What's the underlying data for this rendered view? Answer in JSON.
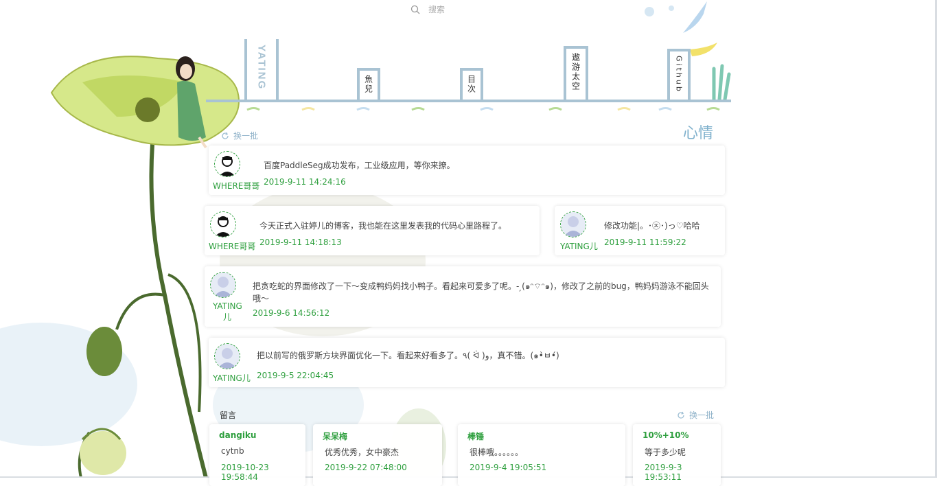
{
  "search": {
    "placeholder": "搜索"
  },
  "nav": {
    "brand": "YATING",
    "tabs": [
      {
        "label": "魚兒"
      },
      {
        "label": "目次"
      },
      {
        "label": "遨游太空"
      },
      {
        "label": "Github"
      }
    ]
  },
  "mood": {
    "refresh_label": "换一批",
    "title": "心情",
    "posts": [
      {
        "author": "WHERE哥哥",
        "content": "百度PaddleSeg成功发布，工业级应用，等你来撩。",
        "time": "2019-9-11 14:24:16"
      },
      {
        "author": "WHERE哥哥",
        "content": "今天正式入驻婷儿的博客，我也能在这里发表我的代码心里路程了。",
        "time": "2019-9-11 14:18:13"
      },
      {
        "author": "YATING儿",
        "content": "修改功能|。･㉨･)っ♡哈哈",
        "time": "2019-9-11 11:59:22"
      },
      {
        "author": "YATING儿",
        "content": "把贪吃蛇的界面修改了一下～变成鸭妈妈找小鸭子。看起来可爱多了呢。- ̗(๑ᵔ⌔ᵔ๑)，修改了之前的bug，鸭妈妈游泳不能回头哦～",
        "time": "2019-9-6 14:56:12"
      },
      {
        "author": "YATING儿",
        "content": "把以前写的俄罗斯方块界面优化一下。看起来好看多了。٩( ᐛ )و，真不错。(๑•̀ㅂ•́)",
        "time": "2019-9-5 22:04:45"
      }
    ]
  },
  "messages": {
    "label": "留言",
    "refresh_label": "换一批",
    "items": [
      {
        "name": "dangiku",
        "text": "cytnb",
        "time": "2019-10-23 19:58:44"
      },
      {
        "name": "呆呆梅",
        "text": "优秀优秀，女中豪杰",
        "time": "2019-9-22 07:48:00"
      },
      {
        "name": "棒锤",
        "text": "很棒哦。。。。。。",
        "time": "2019-9-4 19:05:51"
      },
      {
        "name": "10%+10%",
        "text": "等于多少呢",
        "time": "2019-9-3 19:53:11"
      }
    ]
  },
  "colors": {
    "accent": "#a9c3d3",
    "green": "#2e9f3e",
    "title": "#7eb0cc"
  }
}
